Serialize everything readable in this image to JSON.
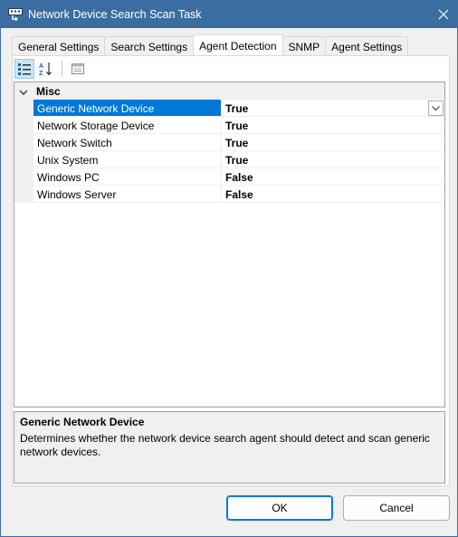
{
  "window": {
    "title": "Network Device Search Scan Task"
  },
  "tabs": [
    {
      "label": "General Settings",
      "active": false
    },
    {
      "label": "Search Settings",
      "active": false
    },
    {
      "label": "Agent Detection",
      "active": true
    },
    {
      "label": "SNMP",
      "active": false
    },
    {
      "label": "Agent Settings",
      "active": false
    }
  ],
  "toolbar": {
    "categorized_icon": "categorized-view-icon",
    "alphabetical_icon": "sort-alphabetical-icon",
    "property_pages_icon": "property-pages-icon"
  },
  "property_grid": {
    "category": "Misc",
    "properties": [
      {
        "name": "Generic Network Device",
        "value": "True"
      },
      {
        "name": "Network Storage Device",
        "value": "True"
      },
      {
        "name": "Network Switch",
        "value": "True"
      },
      {
        "name": "Unix System",
        "value": "True"
      },
      {
        "name": "Windows PC",
        "value": "False"
      },
      {
        "name": "Windows Server",
        "value": "False"
      }
    ],
    "selected_index": 0
  },
  "description": {
    "title": "Generic Network Device",
    "text": "Determines whether the network device search agent should detect and scan generic network devices."
  },
  "buttons": {
    "ok": "OK",
    "cancel": "Cancel"
  },
  "colors": {
    "titlebar": "#3c6da1",
    "selection": "#0078d7"
  }
}
